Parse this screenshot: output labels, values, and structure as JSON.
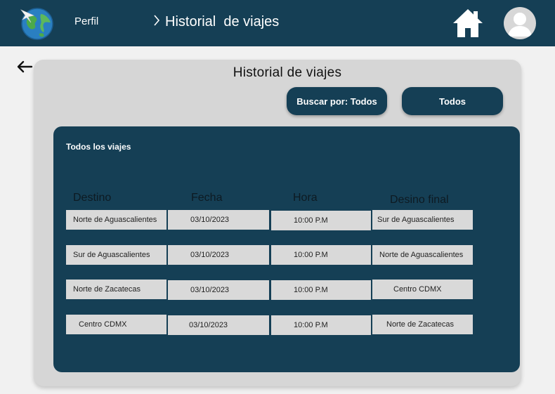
{
  "header": {
    "perfil_label": "Perfil",
    "breadcrumb_separator": ">",
    "breadcrumb_title": "Historial  de viajes",
    "logo_icon": "globe-icon",
    "home_icon": "home-icon",
    "avatar_icon": "user-avatar-icon"
  },
  "page": {
    "back_icon": "arrow-left-icon",
    "title": "Historial de viajes",
    "search_button_label": "Buscar por: Todos",
    "filter_button_label": "Todos"
  },
  "trips": {
    "section_title": "Todos los viajes",
    "columns": [
      "Destino",
      "Fecha",
      "Hora",
      "Desino final"
    ],
    "rows": [
      [
        "Norte de Aguascalientes",
        "03/10/2023",
        "10:00 P.M",
        "Sur de Aguascalientes"
      ],
      [
        "Sur de Aguascalientes",
        "03/10/2023",
        "10:00 P.M",
        "Norte de Aguascalientes"
      ],
      [
        "Norte de Zacatecas",
        "03/10/2023",
        "10:00 P.M",
        "Centro CDMX"
      ],
      [
        "Centro CDMX",
        "03/10/2023",
        "10:00 P.M",
        "Norte de Zacatecas"
      ]
    ]
  },
  "colors": {
    "primary": "#153f55",
    "card": "#d6d6d6",
    "cell": "#d9d9d9",
    "background": "#f1f1f1"
  }
}
